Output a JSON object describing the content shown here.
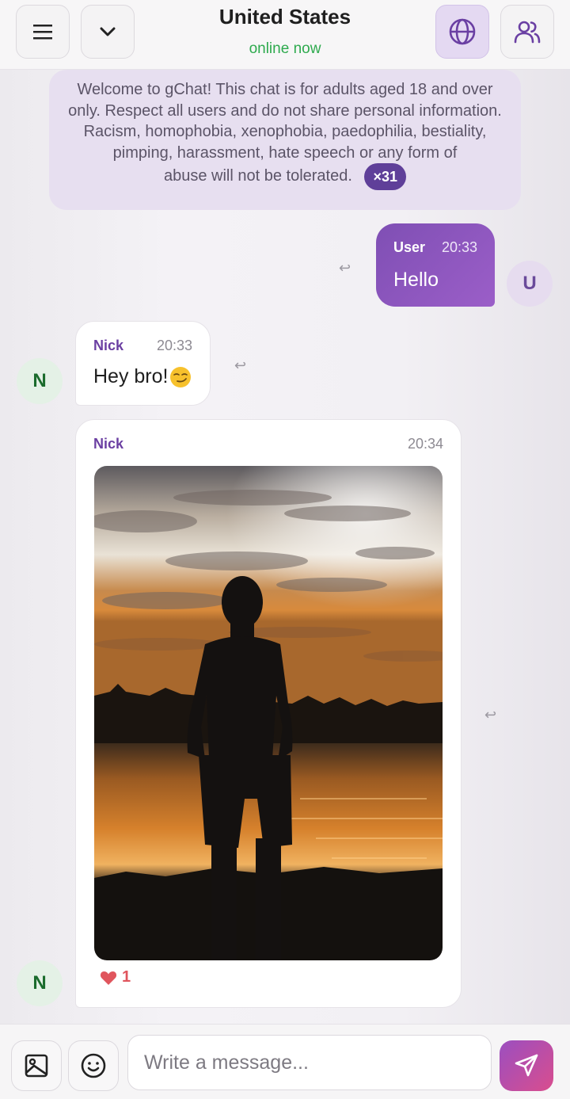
{
  "header": {
    "title": "United States",
    "status": "online now",
    "status_color": "#2eaa4e",
    "icons": [
      "menu-icon",
      "chevron-down-icon",
      "globe-icon",
      "users-icon"
    ]
  },
  "welcome": {
    "text": "Welcome to gChat! This chat is for adults aged 18 and over only. Respect all users and do not share personal information. Racism, homophobia, xenophobia, paedophilia, bestiality, pimping, harassment, hate speech or any form of",
    "text_last": "abuse will not be tolerated.",
    "badge": "×31"
  },
  "messages": [
    {
      "sender": "User",
      "time": "20:33",
      "text": "Hello",
      "avatar": "U",
      "outgoing": true
    },
    {
      "sender": "Nick",
      "time": "20:33",
      "text": "Hey bro!",
      "emoji": "smirking-face",
      "avatar": "N",
      "outgoing": false
    },
    {
      "sender": "Nick",
      "time": "20:34",
      "image": "silhouette-at-sunset-lake",
      "avatar": "N",
      "likes": "1",
      "outgoing": false
    }
  ],
  "composer": {
    "placeholder": "Write a message..."
  },
  "colors": {
    "accent": "#7f4fb4",
    "nick_name": "#6b3fa2",
    "badge": "#5f3f99",
    "like": "#e0555d"
  }
}
